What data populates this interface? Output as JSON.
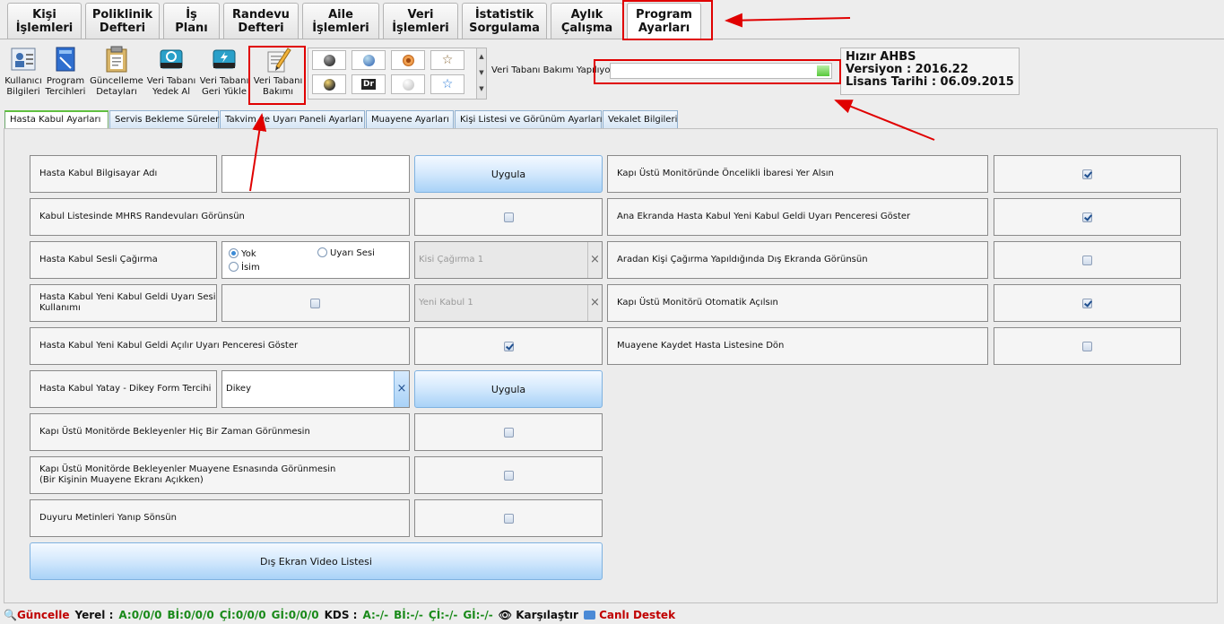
{
  "top_tabs": [
    {
      "l1": "Kişi",
      "l2": "İşlemleri"
    },
    {
      "l1": "Poliklinik",
      "l2": "Defteri"
    },
    {
      "l1": "İş",
      "l2": "Planı"
    },
    {
      "l1": "Randevu",
      "l2": "Defteri"
    },
    {
      "l1": "Aile",
      "l2": "İşlemleri"
    },
    {
      "l1": "Veri",
      "l2": "İşlemleri"
    },
    {
      "l1": "İstatistik",
      "l2": "Sorgulama"
    },
    {
      "l1": "Aylık",
      "l2": "Çalışma"
    },
    {
      "l1": "Program",
      "l2": "Ayarları"
    }
  ],
  "toolbar": [
    {
      "l1": "Kullanıcı",
      "l2": "Bilgileri",
      "icon": "user-card-icon"
    },
    {
      "l1": "Program",
      "l2": "Tercihleri",
      "icon": "program-book-icon"
    },
    {
      "l1": "Güncelleme",
      "l2": "Detayları",
      "icon": "clipboard-icon"
    },
    {
      "l1": "Veri Tabanı",
      "l2": "Yedek Al",
      "icon": "database-backup-icon"
    },
    {
      "l1": "Veri Tabanı",
      "l2": "Geri Yükle",
      "icon": "database-restore-icon"
    },
    {
      "l1": "Veri Tabanı",
      "l2": "Bakımı",
      "icon": "database-maintenance-icon"
    }
  ],
  "themes": {
    "dr_label": "Dr"
  },
  "db_status": {
    "label": "Veri Tabanı Bakımı Yapılıyor"
  },
  "app_info": {
    "name": "Hızır AHBS",
    "version": "Versiyon : 2016.22",
    "license": "Lisans Tarihi : 06.09.2015"
  },
  "sub_tabs": [
    "Hasta Kabul Ayarları",
    "Servis Bekleme Süreleri",
    "Takvim ve Uyarı Paneli Ayarları",
    "Muayene Ayarları",
    "Kişi Listesi ve Görünüm Ayarları",
    "Vekalet Bilgileri"
  ],
  "left": {
    "computer_name_label": "Hasta Kabul Bilgisayar Adı",
    "computer_name_value": "",
    "apply_label": "Uygula",
    "mhrs_label": "Kabul Listesinde MHRS Randevuları Görünsün",
    "voice_call_label": "Hasta Kabul Sesli Çağırma",
    "radio_yok": "Yok",
    "radio_uyari": "Uyarı Sesi",
    "radio_isim": "İsim",
    "voice_select_value": "Kisi Çağırma 1",
    "new_sound_l1": "Hasta Kabul Yeni Kabul Geldi Uyarı Sesi",
    "new_sound_l2": "Kullanımı",
    "new_sound_select_value": "Yeni Kabul 1",
    "popup_label": "Hasta Kabul Yeni Kabul Geldi Açılır Uyarı Penceresi Göster",
    "orientation_label": "Hasta Kabul Yatay - Dikey Form Tercihi",
    "orientation_value": "Dikey",
    "apply2_label": "Uygula",
    "never_show_label": "Kapı Üstü Monitörde Bekleyenler Hiç Bir Zaman Görünmesin",
    "exam_hide_l1": "Kapı Üstü Monitörde Bekleyenler Muayene Esnasında Görünmesin",
    "exam_hide_l2": "(Bir Kişinin Muayene Ekranı Açıkken)",
    "announce_label": "Duyuru Metinleri Yanıp Sönsün",
    "video_list_label": "Dış Ekran Video Listesi"
  },
  "right": [
    {
      "label": "Kapı Üstü Monitöründe Öncelikli İbaresi Yer Alsın",
      "checked": true
    },
    {
      "label": "Ana Ekranda Hasta Kabul Yeni Kabul Geldi Uyarı Penceresi Göster",
      "checked": true
    },
    {
      "label": "Aradan Kişi Çağırma Yapıldığında Dış Ekranda Görünsün",
      "checked": false
    },
    {
      "label": "Kapı Üstü Monitörü Otomatik Açılsın",
      "checked": true
    },
    {
      "label": "Muayene Kaydet Hasta Listesine Dön",
      "checked": false
    }
  ],
  "left_checks": {
    "mhrs": false,
    "new_sound": false,
    "popup": true,
    "never_show": false,
    "exam_hide": false,
    "announce": false
  },
  "status": {
    "update": "Güncelle",
    "local_label": "Yerel :",
    "a": "A:0/0/0",
    "bi": "Bİ:0/0/0",
    "ci": "Çİ:0/0/0",
    "gi": "Gİ:0/0/0",
    "kds_label": "KDS :",
    "ka": "A:-/-",
    "kbi": "Bİ:-/-",
    "kci": "Çİ:-/-",
    "kgi": "Gİ:-/-",
    "compare": "Karşılaştır",
    "support": "Canlı Destek"
  },
  "colors": {
    "accent_red": "#e00000",
    "tab_green": "#5fbf3f",
    "status_green": "#1a8a1a"
  }
}
